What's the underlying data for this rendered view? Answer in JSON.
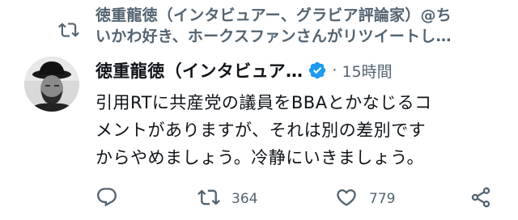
{
  "retweet_context": {
    "line1": "徳重龍徳（インタビュアー、グラビア評論家）@ち",
    "line2": "いかわ好き、ホークスファンさんがリツイートし…"
  },
  "tweet": {
    "author_name": "徳重龍徳（インタビュア…",
    "separator": "·",
    "time": "15時間",
    "text_lines": [
      "引用RTに共産党の議員をBBAとかなじるコ",
      "メントがありますが、それは別の差別です",
      "からやめましょう。冷静にいきましょう。"
    ]
  },
  "actions": {
    "retweet_count": "364",
    "like_count": "779"
  },
  "colors": {
    "text_primary": "#0f1419",
    "text_secondary": "#536471",
    "verified_blue": "#1d9bf0"
  },
  "icons": {
    "retweet_context": "retweet-icon",
    "verified": "verified-badge-icon",
    "reply": "reply-icon",
    "retweet": "retweet-icon",
    "like": "heart-icon",
    "share": "share-icon"
  }
}
